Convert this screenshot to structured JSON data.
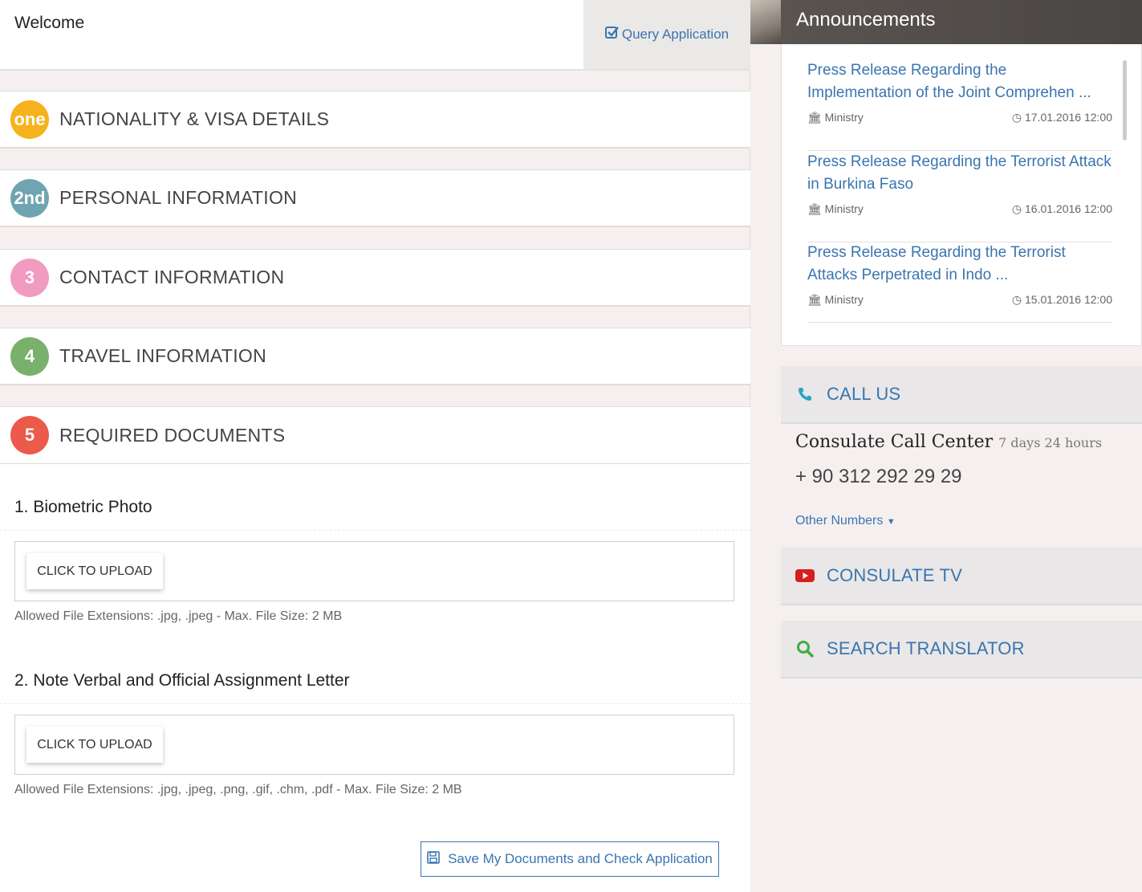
{
  "header": {
    "welcome": "Welcome",
    "query_icon": "check-square-icon",
    "query_label": "Query Application"
  },
  "steps": [
    {
      "badge": "one",
      "title": "NATIONALITY & VISA DETAILS",
      "color": "#f6b21c"
    },
    {
      "badge": "2nd",
      "title": "PERSONAL INFORMATION",
      "color": "#6fa5b0"
    },
    {
      "badge": "3",
      "title": "CONTACT INFORMATION",
      "color": "#f29bc1"
    },
    {
      "badge": "4",
      "title": "TRAVEL INFORMATION",
      "color": "#79b06b"
    },
    {
      "badge": "5",
      "title": "REQUIRED DOCUMENTS",
      "color": "#ec5a4b"
    }
  ],
  "documents": [
    {
      "title": "1. Biometric Photo",
      "button": "CLICK TO UPLOAD",
      "allowed": "Allowed File Extensions: .jpg, .jpeg - Max. File Size: 2 MB"
    },
    {
      "title": "2. Note Verbal and Official Assignment Letter",
      "button": "CLICK TO UPLOAD",
      "allowed": "Allowed File Extensions: .jpg, .jpeg, .png, .gif, .chm, .pdf - Max. File Size: 2 MB"
    }
  ],
  "save_button": {
    "icon": "floppy-disk-icon",
    "label": "Save My Documents and Check Application"
  },
  "announcements": {
    "title": "Announcements",
    "items": [
      {
        "title": "Press Release Regarding the Implementation of the Joint Comprehen ...",
        "source": "Ministry",
        "date": "17.01.2016 12:00"
      },
      {
        "title": "Press Release Regarding the Terrorist Attack in Burkina Faso",
        "source": "Ministry",
        "date": "16.01.2016 12:00"
      },
      {
        "title": "Press Release Regarding the Terrorist Attacks Perpetrated in Indo ...",
        "source": "Ministry",
        "date": "15.01.2016 12:00"
      }
    ]
  },
  "call_us": {
    "icon": "phone-icon",
    "label": "CALL US",
    "center": "Consulate Call Center",
    "hours": "7 days 24 hours",
    "phone": "+ 90 312 292 29 29",
    "other": "Other Numbers"
  },
  "consulate_tv": {
    "icon": "youtube-icon",
    "label": "CONSULATE TV"
  },
  "search_translator": {
    "icon": "search-icon",
    "label": "SEARCH TRANSLATOR"
  },
  "colors": {
    "link": "#3a75b0",
    "phone_icon": "#2aa3c8",
    "youtube": "#d71e1e",
    "search_icon": "#3fae3f"
  }
}
